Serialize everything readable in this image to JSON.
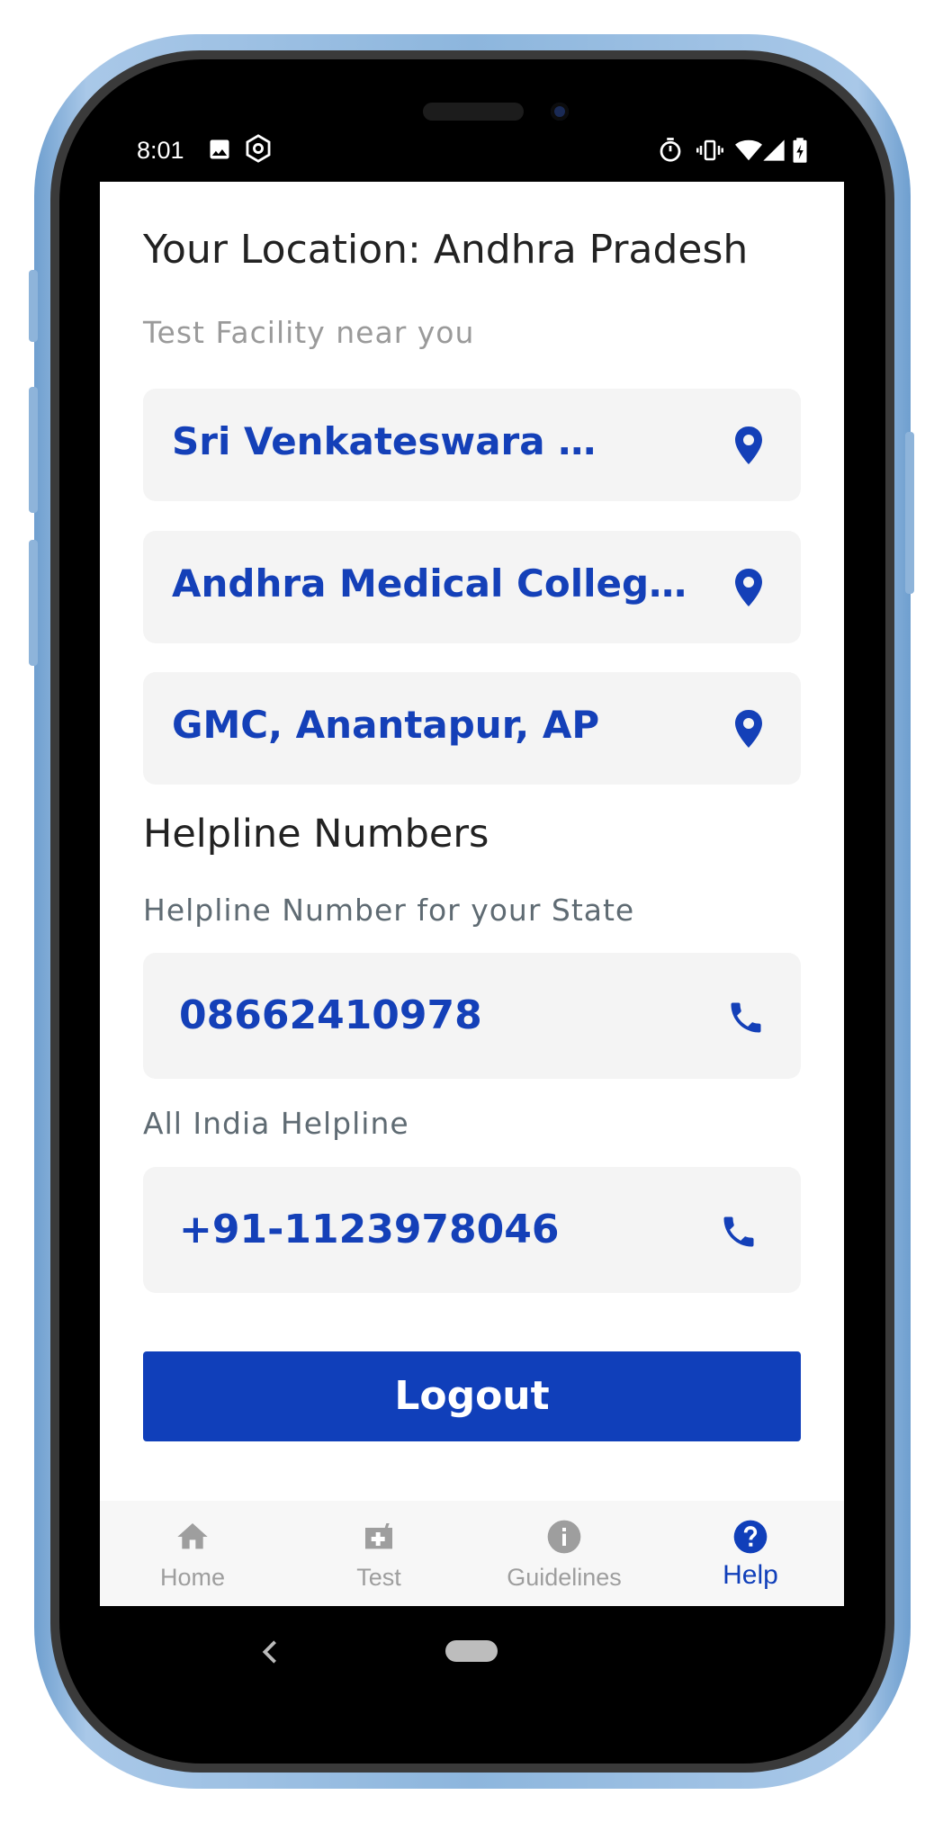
{
  "status_bar": {
    "time": "8:01"
  },
  "location": {
    "title": "Your Location: Andhra Pradesh",
    "subtitle": "Test Facility near you"
  },
  "facilities": [
    {
      "name": "Sri Venkateswara …"
    },
    {
      "name": "Andhra Medical College,…"
    },
    {
      "name": "GMC, Anantapur, AP"
    }
  ],
  "helpline": {
    "title": "Helpline Numbers",
    "state_label": "Helpline Number for your State",
    "state_number": "08662410978",
    "india_label": "All India Helpline",
    "india_number": "+91-1123978046"
  },
  "logout_label": "Logout",
  "bottom_nav": [
    {
      "label": "Home",
      "icon": "home-icon",
      "active": false
    },
    {
      "label": "Test",
      "icon": "test-kit-icon",
      "active": false
    },
    {
      "label": "Guidelines",
      "icon": "info-icon",
      "active": false
    },
    {
      "label": "Help",
      "icon": "help-icon",
      "active": true
    }
  ],
  "colors": {
    "accent": "#103fba",
    "card_text": "#1440b8",
    "card_bg": "#f4f4f4",
    "inactive_nav": "#9e9e9e"
  }
}
